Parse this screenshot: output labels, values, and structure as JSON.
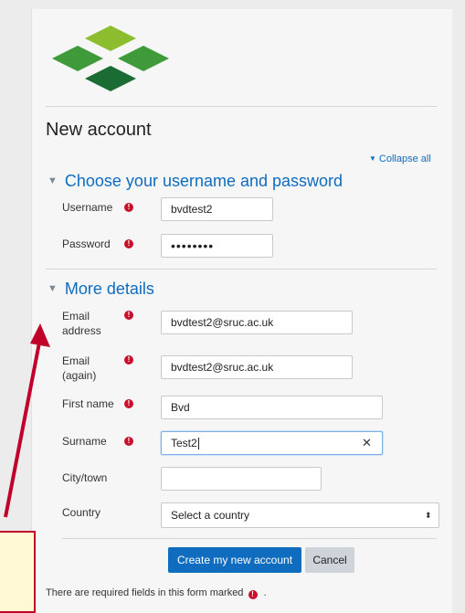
{
  "page": {
    "title": "New account",
    "collapse_all": "Collapse all"
  },
  "sections": {
    "login": {
      "heading": "Choose your username and password"
    },
    "details": {
      "heading": "More details"
    }
  },
  "fields": {
    "username": {
      "label": "Username",
      "value": "bvdtest2"
    },
    "password": {
      "label": "Password",
      "value": "••••••••"
    },
    "email": {
      "label_line1": "Email",
      "label_line2": "address",
      "value": "bvdtest2@sruc.ac.uk"
    },
    "email2": {
      "label_line1": "Email",
      "label_line2": "(again)",
      "value": "bvdtest2@sruc.ac.uk"
    },
    "firstname": {
      "label": "First name",
      "value": "Bvd"
    },
    "surname": {
      "label": "Surname",
      "value": "Test2"
    },
    "city": {
      "label": "City/town",
      "value": ""
    },
    "country": {
      "label": "Country",
      "value": "Select a country"
    }
  },
  "buttons": {
    "create": "Create my new account",
    "cancel": "Cancel"
  },
  "footer": {
    "note_prefix": "There are required fields in this form marked",
    "note_suffix": "."
  },
  "icons": {
    "required": "exclamation-circle-icon",
    "clear": "close-icon",
    "select": "chevron-updown-icon"
  },
  "colors": {
    "link": "#0f6cbf",
    "required": "#c8102e",
    "logo_light": "#8cbd2e",
    "logo_mid": "#3f9a3a",
    "logo_dark": "#1a6b34",
    "callout_border": "#c0002a"
  }
}
